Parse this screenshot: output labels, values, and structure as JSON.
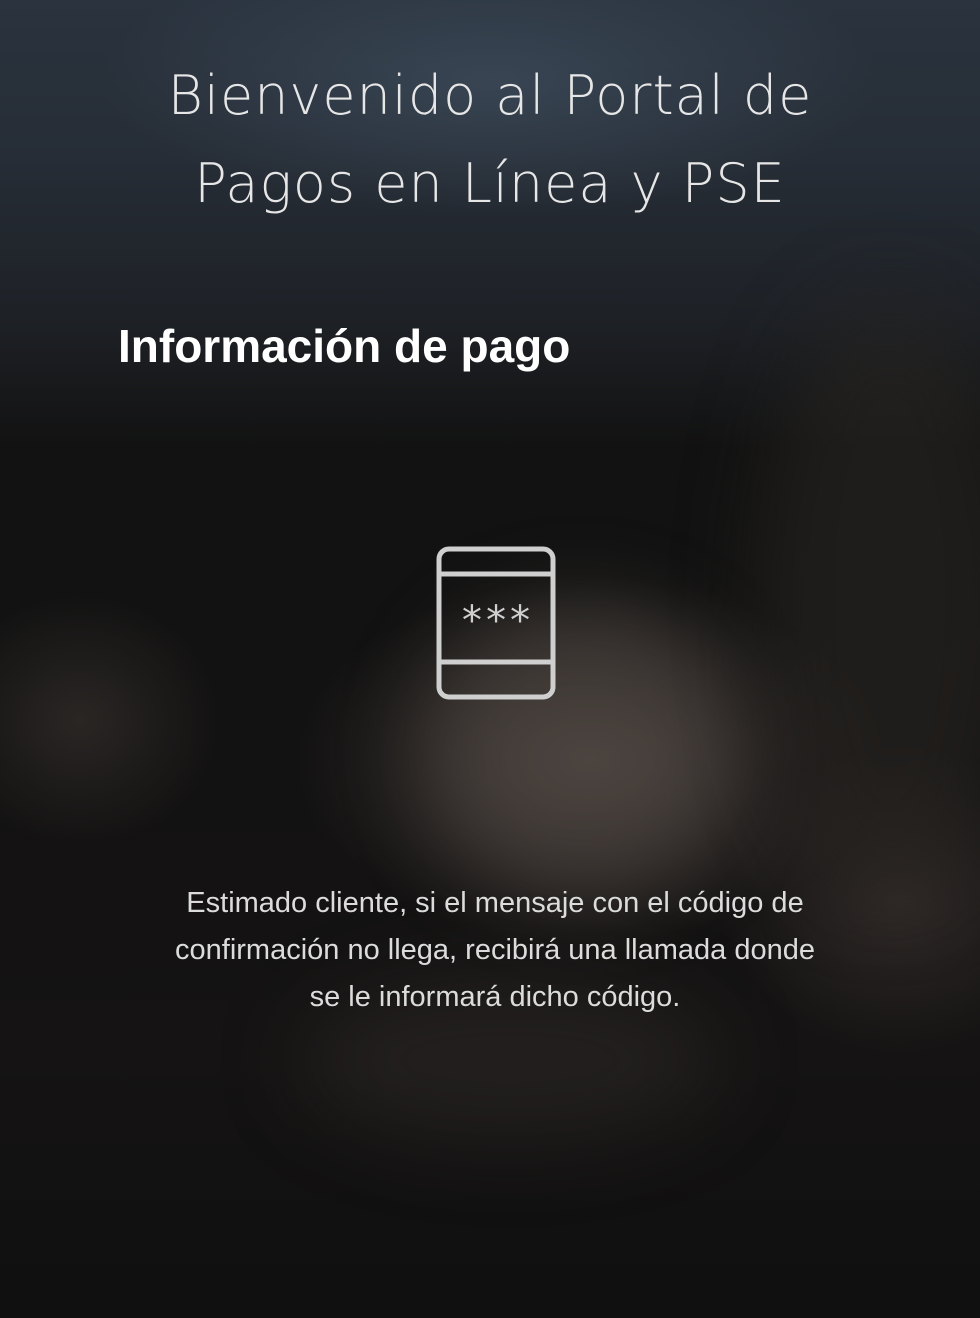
{
  "header": {
    "title_line1": "Bienvenido al Portal de",
    "title_line2": "Pagos en Línea y PSE"
  },
  "section": {
    "title": "Información de pago"
  },
  "icon": {
    "name": "phone-code-icon",
    "code_mask": "***",
    "color": "#cfcfcf"
  },
  "message": {
    "line1": "Estimado cliente, si el mensaje con el código de",
    "line2": "confirmación no llega, recibirá una llamada donde",
    "line3": "se le informará dicho código."
  }
}
